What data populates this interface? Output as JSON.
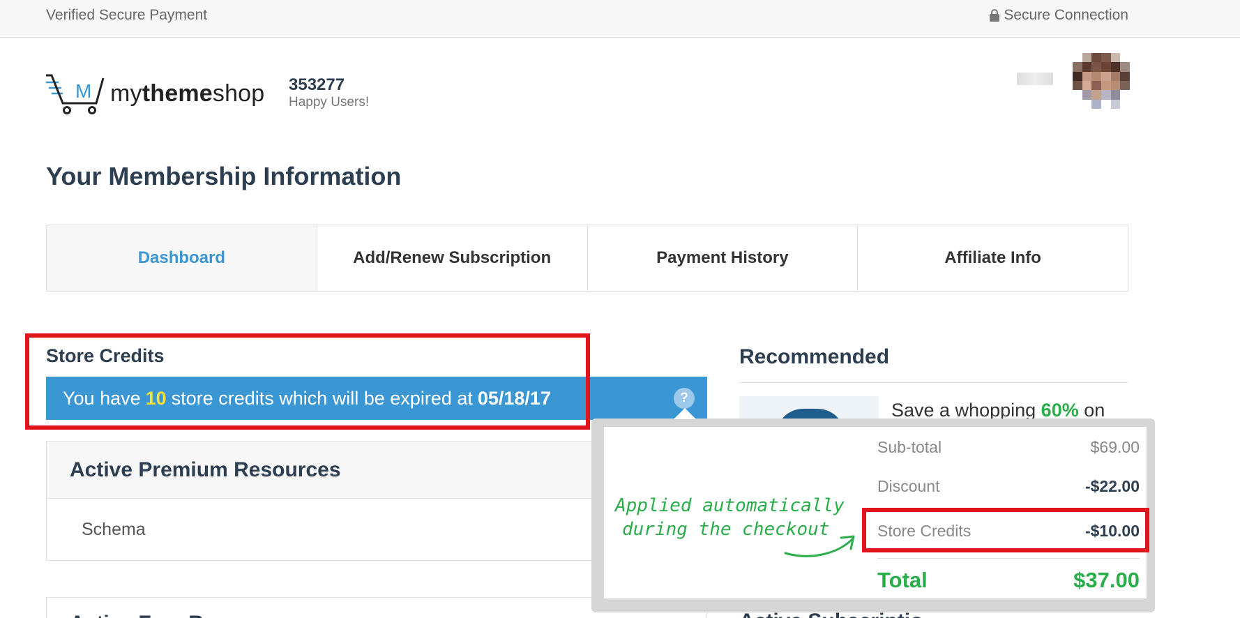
{
  "topbar": {
    "left_text": "Verified Secure Payment",
    "right_text": "Secure Connection"
  },
  "header": {
    "logo_prefix": "my",
    "logo_bold": "theme",
    "logo_suffix": "shop",
    "logo_mark": "M",
    "user_count": "353277",
    "user_count_label": "Happy Users!"
  },
  "page": {
    "title": "Your Membership Information"
  },
  "tabs": [
    {
      "label": "Dashboard"
    },
    {
      "label": "Add/Renew Subscription"
    },
    {
      "label": "Payment History"
    },
    {
      "label": "Affiliate Info"
    }
  ],
  "store_credits": {
    "title": "Store Credits",
    "text_before": "You have",
    "credits": "10",
    "text_middle": "store credits which will be expired at",
    "expiry_date": "05/18/17",
    "help_symbol": "?"
  },
  "premium_resources": {
    "title": "Active Premium Resources",
    "items": [
      "Schema"
    ]
  },
  "free_resources": {
    "title": "Active Free R"
  },
  "recommended": {
    "title": "Recommended",
    "text_before": "Save a whopping",
    "percent": "60%",
    "text_after": "on"
  },
  "subscriptions": {
    "title": "Active Subscriptio"
  },
  "order_summary": {
    "subtotal_label": "Sub-total",
    "subtotal_value": "$69.00",
    "discount_label": "Discount",
    "discount_value": "-$22.00",
    "credits_label": "Store Credits",
    "credits_value": "-$10.00",
    "total_label": "Total",
    "total_value": "$37.00"
  },
  "annotation": {
    "line1": "Applied automatically",
    "line2": "during the checkout"
  },
  "colors": {
    "accent_blue": "#3a97d4",
    "highlight_red": "#e0141b",
    "success_green": "#2aae4a",
    "credit_yellow": "#f5e03a"
  }
}
